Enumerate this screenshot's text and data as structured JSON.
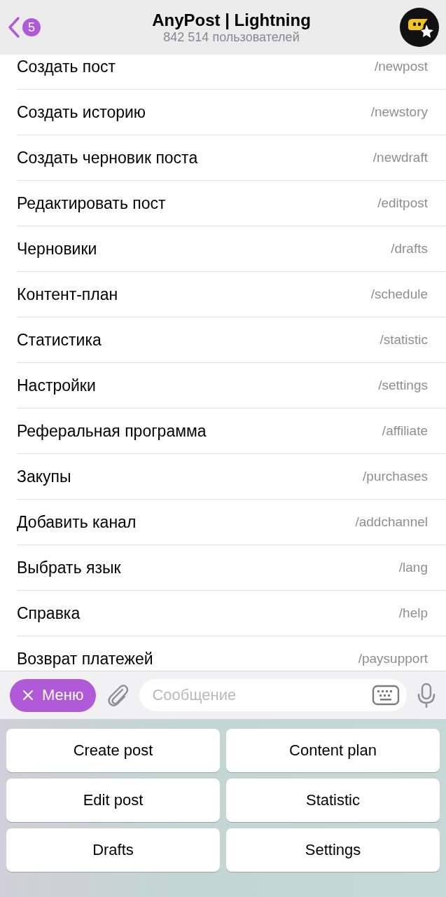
{
  "header": {
    "back_badge": "5",
    "title": "AnyPost | Lightning",
    "subtitle": "842 514 пользователей"
  },
  "commands": [
    {
      "label": "Создать пост",
      "command": "/newpost"
    },
    {
      "label": "Создать историю",
      "command": "/newstory"
    },
    {
      "label": "Создать черновик поста",
      "command": "/newdraft"
    },
    {
      "label": "Редактировать пост",
      "command": "/editpost"
    },
    {
      "label": "Черновики",
      "command": "/drafts"
    },
    {
      "label": "Контент-план",
      "command": "/schedule"
    },
    {
      "label": "Статистика",
      "command": "/statistic"
    },
    {
      "label": "Настройки",
      "command": "/settings"
    },
    {
      "label": "Реферальная программа",
      "command": "/affiliate"
    },
    {
      "label": "Закупы",
      "command": "/purchases"
    },
    {
      "label": "Добавить канал",
      "command": "/addchannel"
    },
    {
      "label": "Выбрать язык",
      "command": "/lang"
    },
    {
      "label": "Справка",
      "command": "/help"
    },
    {
      "label": "Возврат платежей",
      "command": "/paysupport"
    }
  ],
  "input_bar": {
    "menu_button": "Меню",
    "placeholder": "Сообщение"
  },
  "keyboard": [
    "Create post",
    "Content plan",
    "Edit post",
    "Statistic",
    "Drafts",
    "Settings"
  ]
}
